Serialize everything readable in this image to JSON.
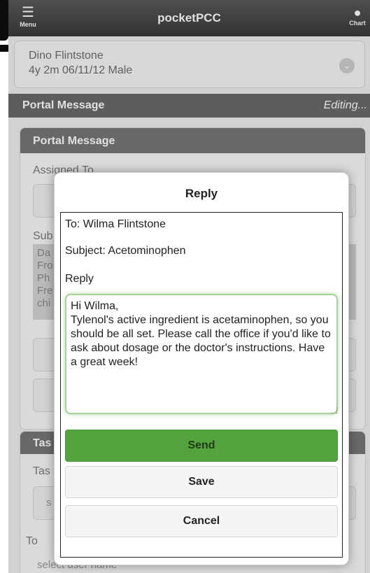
{
  "header": {
    "menu_label": "Menu",
    "title": "pocketPCC",
    "chart_label": "Chart"
  },
  "patient": {
    "name": "Dino Flintstone",
    "meta": "4y 2m  06/11/12  Male"
  },
  "section": {
    "title": "Portal Message",
    "status": "Editing..."
  },
  "background": {
    "card_title": "Portal Message",
    "assigned_label": "Assigned To",
    "subject_label": "Sub",
    "grey_lines": [
      "Da",
      "Fro",
      "Ph",
      "Fre",
      "chi"
    ],
    "task_card_title": "Tas",
    "task_label": "Tas",
    "task_value": "s",
    "to_label": "To",
    "select_placeholder": "select user name"
  },
  "modal": {
    "title": "Reply",
    "to_line": "To: Wilma Flintstone",
    "subject_line": "Subject: Acetominophen",
    "reply_label": "Reply",
    "reply_text": "Hi Wilma,\nTylenol's active ingredient is acetaminophen, so you should be all set. Please call the office if you'd like to ask about dosage or the doctor's instructions. Have a great week!",
    "send_label": "Send",
    "save_label": "Save",
    "cancel_label": "Cancel"
  },
  "colors": {
    "send_green": "#54a33f",
    "header_dark": "#3a3a3a",
    "focus_green": "#a7d49a"
  }
}
